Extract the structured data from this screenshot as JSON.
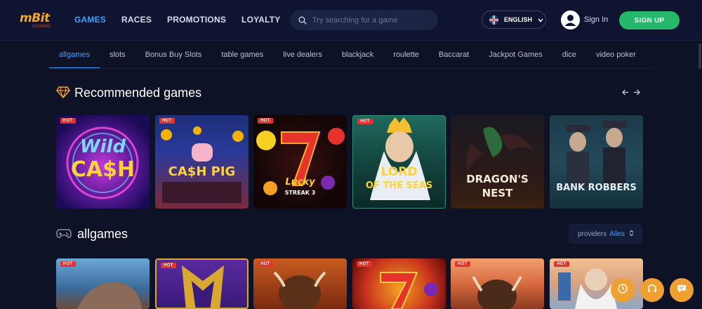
{
  "header": {
    "logo_text": "mBit",
    "logo_sub": "CASINO",
    "nav": [
      "GAMES",
      "RACES",
      "PROMOTIONS",
      "LOYALTY"
    ],
    "search_placeholder": "Try searching for a game",
    "language": "ENGLISH",
    "signin": "Sign In",
    "signup": "SIGN UP"
  },
  "categories": [
    "allgames",
    "slots",
    "Bonus Buy Slots",
    "table games",
    "live dealers",
    "blackjack",
    "roulette",
    "Baccarat",
    "Jackpot Games",
    "dice",
    "video poker"
  ],
  "recommended": {
    "title": "Recommended games",
    "games": [
      {
        "badge": "HOT",
        "title_line1": "Wild",
        "title_line2": "CA$H"
      },
      {
        "badge": "HOT",
        "title_line1": "CA$H PIG",
        "title_line2": ""
      },
      {
        "badge": "HOT",
        "title_line1": "Lucky",
        "title_line2": "STREAK 3"
      },
      {
        "badge": "HOT",
        "title_line1": "LORD",
        "title_line2": "OF THE SEAS"
      },
      {
        "badge": "",
        "title_line1": "DRAGON'S",
        "title_line2": "NEST"
      },
      {
        "badge": "",
        "title_line1": "BANK ROBBERS",
        "title_line2": ""
      }
    ]
  },
  "allgames": {
    "title": "allgames",
    "providers_label": "providers",
    "providers_value": "Alles",
    "games": [
      {
        "badge": "HOT"
      },
      {
        "badge": "HOT"
      },
      {
        "badge": "HOT"
      },
      {
        "badge": "HOT"
      },
      {
        "badge": "HOT"
      },
      {
        "badge": "HOT"
      }
    ]
  },
  "colors": {
    "background": "#0d1226",
    "accent": "#3ea0ff",
    "signup": "#26b86a",
    "hot_badge": "#e8322e",
    "fab": "#f0a030"
  },
  "icons": [
    "search-icon",
    "flag-uk-icon",
    "chevron-down-icon",
    "user-icon",
    "diamond-icon",
    "gamepad-icon",
    "arrow-left-icon",
    "arrow-right-icon",
    "sort-icon",
    "clock-icon",
    "headset-icon",
    "chat-icon"
  ]
}
